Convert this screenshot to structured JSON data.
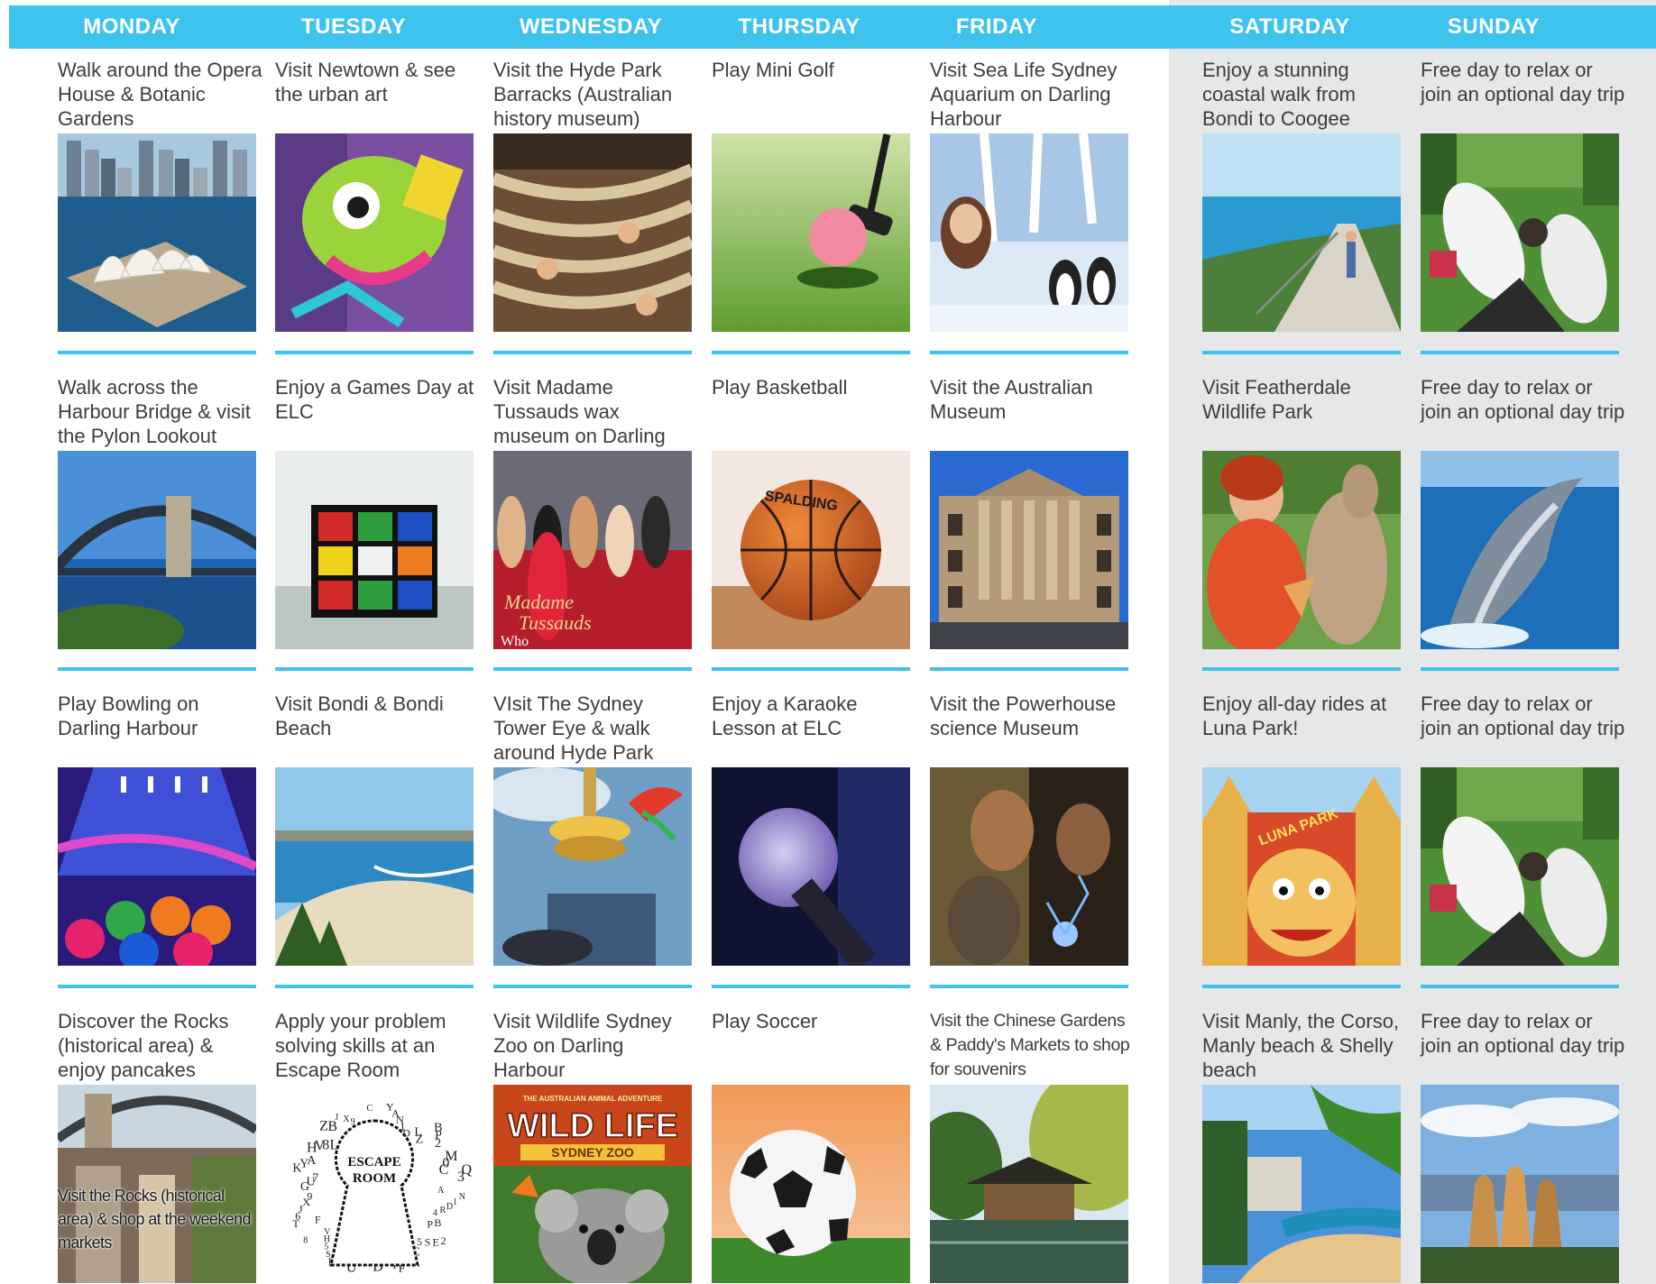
{
  "days": [
    "MONDAY",
    "TUESDAY",
    "WEDNESDAY",
    "THURSDAY",
    "FRIDAY",
    "SATURDAY",
    "SUNDAY"
  ],
  "colors": {
    "header": "#3dc3ee",
    "weekend_panel": "#e5e7e8",
    "text": "#3d3d3d"
  },
  "weeks": [
    [
      {
        "text": "Walk around the Opera House & Botanic Gardens",
        "image": "opera-house-photo"
      },
      {
        "text": "Visit Newtown & see the urban art",
        "image": "street-art-photo"
      },
      {
        "text": "Visit the Hyde Park Barracks (Australian history museum)",
        "image": "hammocks-photo"
      },
      {
        "text": "Play Mini Golf",
        "image": "mini-golf-photo"
      },
      {
        "text": "Visit Sea Life Sydney Aquarium on Darling Harbour",
        "image": "penguins-photo"
      },
      {
        "text": "Enjoy a stunning coastal walk from Bondi to Coogee",
        "image": "coastal-walk-photo"
      },
      {
        "text": "Free day to relax or join an optional day trip",
        "image": "relax-feet-photo"
      }
    ],
    [
      {
        "text": "Walk across the Harbour Bridge & visit the Pylon Lookout",
        "image": "harbour-bridge-photo"
      },
      {
        "text": "Enjoy a Games Day at ELC",
        "image": "rubiks-cube-photo"
      },
      {
        "text": "Visit Madame Tussauds wax museum on Darling Harbour",
        "image": "madame-tussauds-photo"
      },
      {
        "text": "Play Basketball",
        "image": "basketball-photo"
      },
      {
        "text": "Visit the Australian Museum",
        "image": "museum-building-photo"
      },
      {
        "text": "Visit Featherdale Wildlife Park",
        "image": "kangaroo-photo"
      },
      {
        "text": "Free day to relax or join an optional day trip",
        "image": "dolphin-photo"
      }
    ],
    [
      {
        "text": "Play Bowling on Darling Harbour",
        "image": "bowling-photo"
      },
      {
        "text": "Visit Bondi & Bondi Beach",
        "image": "bondi-beach-photo"
      },
      {
        "text": "VIsit The Sydney Tower Eye & walk around Hyde Park",
        "image": "sydney-tower-photo"
      },
      {
        "text": "Enjoy a Karaoke Lesson at ELC",
        "image": "microphone-photo"
      },
      {
        "text": "Visit the Powerhouse science Museum",
        "image": "plasma-ball-photo"
      },
      {
        "text": "Enjoy all-day rides at Luna Park!",
        "image": "luna-park-photo"
      },
      {
        "text": "Free day to relax or join an optional day trip",
        "image": "relax-feet-photo"
      }
    ],
    [
      {
        "text": "Discover the Rocks (historical area) & enjoy pancakes",
        "image": "the-rocks-photo",
        "overlay": "Visit the Rocks (historical area) & shop at the weekend markets"
      },
      {
        "text": "Apply your problem solving skills at an Escape Room",
        "image": "escape-room-photo"
      },
      {
        "text": "Visit Wildlife Sydney Zoo on Darling Harbour",
        "image": "wild-life-zoo-photo"
      },
      {
        "text": "Play Soccer",
        "image": "soccer-ball-photo"
      },
      {
        "text": "Visit the Chinese Gardens & Paddy's Markets to shop for souvenirs",
        "image": "chinese-garden-photo",
        "condensed": true
      },
      {
        "text": "Visit Manly, the Corso, Manly beach & Shelly beach",
        "image": "manly-beach-photo"
      },
      {
        "text": "Free day to relax or join an optional day trip",
        "image": "blue-mountains-photo"
      }
    ]
  ],
  "image_text": {
    "escape_room": "ESCAPE ROOM",
    "wild_life": "WILD LIFE",
    "wild_life_sub": "SYDNEY ZOO",
    "wild_life_top": "THE AUSTRALIAN ANIMAL ADVENTURE",
    "tussauds": "Madame Tussauds",
    "tussauds_sub": "Who",
    "spalding": "SPALDING",
    "luna": "LUNA PARK"
  }
}
